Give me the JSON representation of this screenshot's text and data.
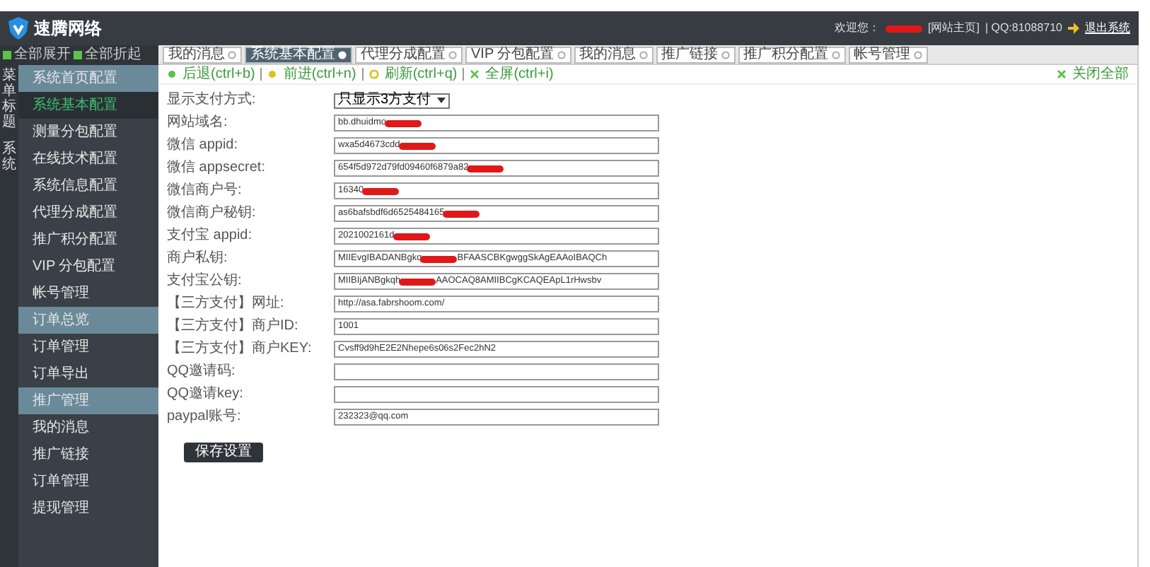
{
  "header": {
    "logo": "速腾网络",
    "welcome": "欢迎您：",
    "user_redacted": true,
    "home_link": "[网站主页]",
    "qq": "| QQ:81088710",
    "logout": "退出系统"
  },
  "sidebar": {
    "expand_all": "全部展开",
    "collapse_all": "全部折起",
    "menu_title": "菜单标题",
    "group": "系统",
    "items": [
      {
        "label": "系统首页配置",
        "kind": "header",
        "selected": false
      },
      {
        "label": "系统基本配置",
        "kind": "item",
        "selected": true
      },
      {
        "label": "测量分包配置",
        "kind": "item",
        "selected": false
      },
      {
        "label": "在线技术配置",
        "kind": "item",
        "selected": false
      },
      {
        "label": "系统信息配置",
        "kind": "item",
        "selected": false
      },
      {
        "label": "代理分成配置",
        "kind": "item",
        "selected": false
      },
      {
        "label": "推广积分配置",
        "kind": "item",
        "selected": false
      },
      {
        "label": "VIP 分包配置",
        "kind": "item",
        "selected": false
      },
      {
        "label": "帐号管理",
        "kind": "item",
        "selected": false
      },
      {
        "label": "订单总览",
        "kind": "header",
        "selected": false
      },
      {
        "label": "订单管理",
        "kind": "item",
        "selected": false
      },
      {
        "label": "订单导出",
        "kind": "item",
        "selected": false
      },
      {
        "label": "推广管理",
        "kind": "header",
        "selected": false
      },
      {
        "label": "我的消息",
        "kind": "item",
        "selected": false
      },
      {
        "label": "推广链接",
        "kind": "item",
        "selected": false
      },
      {
        "label": "订单管理",
        "kind": "item",
        "selected": false
      },
      {
        "label": "提现管理",
        "kind": "item",
        "selected": false
      }
    ]
  },
  "tabs": [
    {
      "label": "我的消息",
      "selected": false
    },
    {
      "label": "系统基本配置",
      "selected": true
    },
    {
      "label": "代理分成配置",
      "selected": false
    },
    {
      "label": "VIP 分包配置",
      "selected": false
    },
    {
      "label": "我的消息",
      "selected": false
    },
    {
      "label": "推广链接",
      "selected": false
    },
    {
      "label": "推广积分配置",
      "selected": false
    },
    {
      "label": "帐号管理",
      "selected": false
    }
  ],
  "toolbar": [
    {
      "label": "后退(ctrl+b)",
      "kind": "back"
    },
    {
      "label": "前进(ctrl+n)",
      "kind": "forward"
    },
    {
      "label": "刷新(ctrl+q)",
      "kind": "refresh"
    },
    {
      "label": "全屏(ctrl+i)",
      "kind": "fullscreen"
    }
  ],
  "close_all": "关闭全部",
  "form": [
    {
      "label": "显示支付方式:",
      "kind": "select",
      "value": "只显示3方支付"
    },
    {
      "label": "网站域名:",
      "kind": "text",
      "value": "bb.dhuidmo",
      "redacted": true
    },
    {
      "label": "微信 appid:",
      "kind": "text",
      "value": "wxa5d4673cdd",
      "redacted": true
    },
    {
      "label": "微信 appsecret:",
      "kind": "text",
      "value": "654f5d972d79fd09460f6879a82",
      "redacted": true
    },
    {
      "label": "微信商户号:",
      "kind": "text",
      "value": "16340",
      "redacted": true
    },
    {
      "label": "微信商户秘钥:",
      "kind": "text",
      "value": "as6bafsbdf6d6525484165",
      "redacted": true
    },
    {
      "label": "支付宝 appid:",
      "kind": "text",
      "value": "2021002161d",
      "redacted": true
    },
    {
      "label": "商户私钥:",
      "kind": "text",
      "value": "MIIEvgIBADANBgkq",
      "value_end": "BFAASCBKgwggSkAgEAAoIBAQCh",
      "redacted": true
    },
    {
      "label": "支付宝公钥:",
      "kind": "text",
      "value": "MIIBIjANBgkqh",
      "value_end": "AAOCAQ8AMIIBCgKCAQEApL1rHwsbv",
      "redacted": true
    },
    {
      "label": "【三方支付】网址:",
      "kind": "text",
      "value": "http://asa.fabrshoom.com/"
    },
    {
      "label": "【三方支付】商户ID:",
      "kind": "text",
      "value": "1001"
    },
    {
      "label": "【三方支付】商户KEY:",
      "kind": "text",
      "value": "Cvsff9d9hE2E2Nhepe6s06s2Fec2hN2"
    },
    {
      "label": "QQ邀请码:",
      "kind": "text"
    },
    {
      "label": "QQ邀请key:",
      "kind": "text"
    },
    {
      "label": "paypal账号:",
      "kind": "text",
      "value": "232323@qq.com"
    }
  ],
  "save_button": "保存设置"
}
